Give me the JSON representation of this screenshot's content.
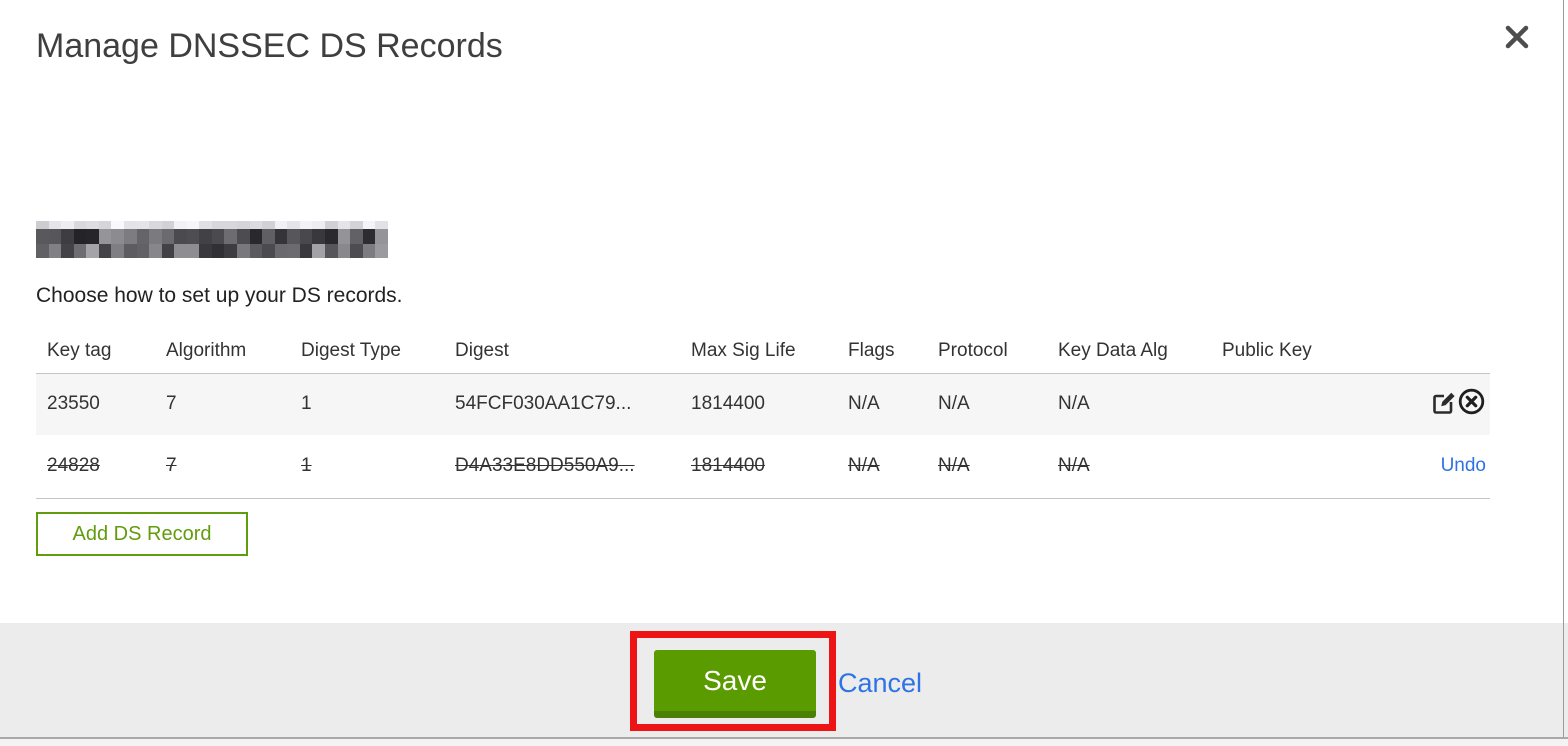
{
  "modal": {
    "title": "Manage DNSSEC DS Records",
    "subtitle": "Choose how to set up your DS records.",
    "domain": "(redacted/pixelated domain name)",
    "table": {
      "columns": [
        "Key tag",
        "Algorithm",
        "Digest Type",
        "Digest",
        "Max Sig Life",
        "Flags",
        "Protocol",
        "Key Data Alg",
        "Public Key"
      ],
      "rows": [
        {
          "key_tag": "23550",
          "algorithm": "7",
          "digest_type": "1",
          "digest": "54FCF030AA1C79...",
          "max_sig_life": "1814400",
          "flags": "N/A",
          "protocol": "N/A",
          "key_data_alg": "N/A",
          "public_key": "",
          "state": "normal"
        },
        {
          "key_tag": "24828",
          "algorithm": "7",
          "digest_type": "1",
          "digest": "D4A33E8DD550A9...",
          "max_sig_life": "1814400",
          "flags": "N/A",
          "protocol": "N/A",
          "key_data_alg": "N/A",
          "public_key": "",
          "state": "deleted",
          "undo_label": "Undo"
        }
      ]
    },
    "add_button_label": "Add DS Record",
    "footer": {
      "save_label": "Save",
      "cancel_label": "Cancel"
    }
  },
  "icons": {
    "close": "x-cross",
    "edit": "pencil-on-square",
    "delete": "x-in-circle"
  },
  "annotation": {
    "type": "red-rectangle-highlight",
    "target": "save-button",
    "color": "#ec1414"
  },
  "colors": {
    "primary_green": "#5a9b00",
    "green_button_shadow": "#4a8004",
    "outline_green": "#619c0c",
    "link_blue": "#2e73e5",
    "row_stripe_gray": "#f6f6f6",
    "footer_gray": "#ececec",
    "text_dark": "#333333"
  }
}
